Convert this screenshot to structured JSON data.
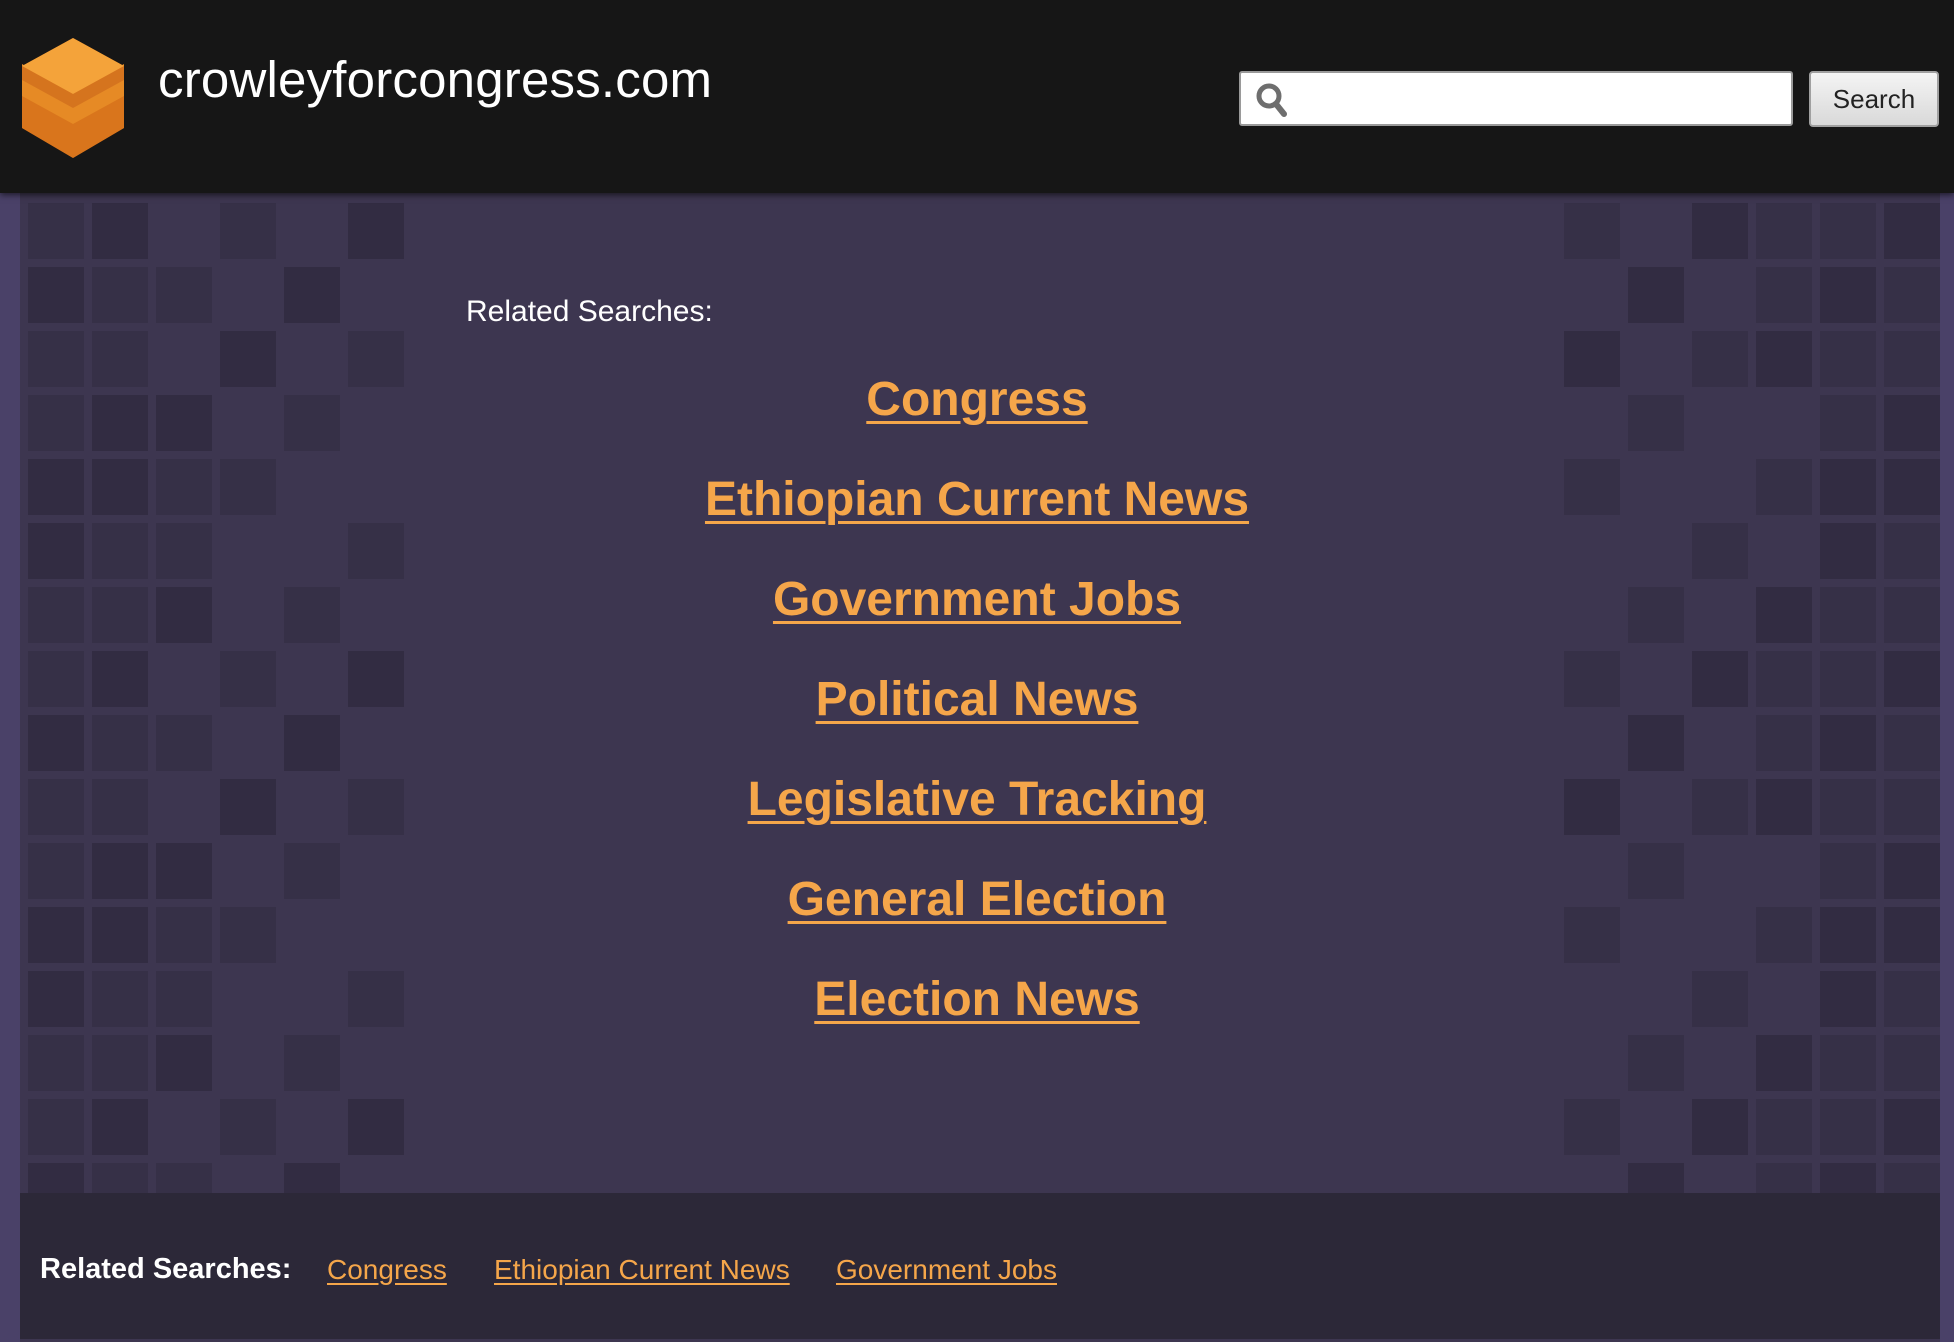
{
  "header": {
    "site_name": "crowleyforcongress.com",
    "logo_icon": "orange-layered-cube-icon",
    "search": {
      "value": "",
      "placeholder": "",
      "icon": "search-icon",
      "button_label": "Search"
    }
  },
  "main": {
    "related_heading": "Related Searches:",
    "links": [
      "Congress",
      "Ethiopian Current News",
      "Government Jobs",
      "Political News",
      "Legislative Tracking",
      "General Election",
      "Election News"
    ]
  },
  "footer": {
    "label": "Related Searches:",
    "links": [
      "Congress",
      "Ethiopian Current News",
      "Government Jobs"
    ]
  },
  "colors": {
    "header_bg": "#161616",
    "page_bg": "#3d3650",
    "link": "#f5a64a",
    "footer_bg": "#2c2838"
  }
}
